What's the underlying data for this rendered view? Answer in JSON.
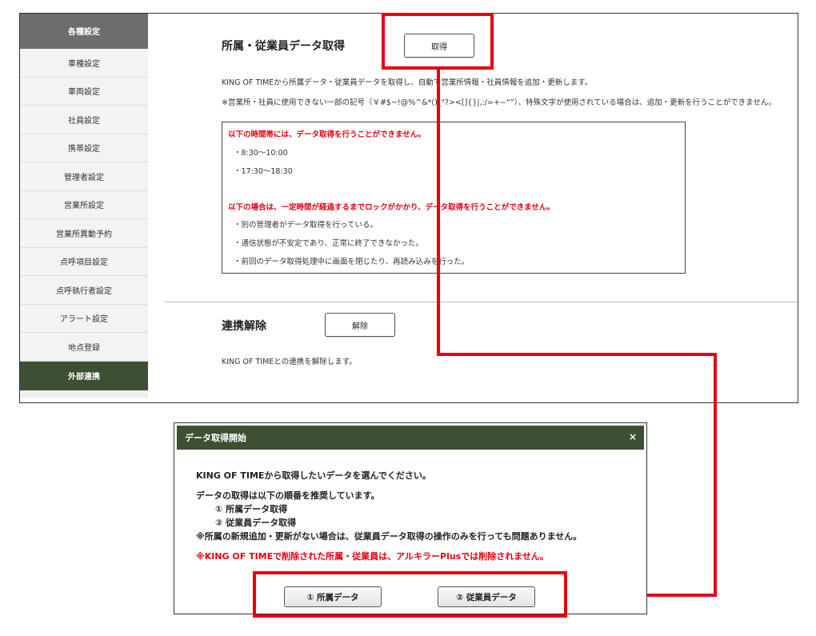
{
  "sidebar": {
    "header": "各種設定",
    "items": [
      {
        "label": "車種設定"
      },
      {
        "label": "車両設定"
      },
      {
        "label": "社員設定"
      },
      {
        "label": "携帯設定"
      },
      {
        "label": "管理者設定"
      },
      {
        "label": "営業所設定"
      },
      {
        "label": "営業所異動予約"
      },
      {
        "label": "点呼項目設定"
      },
      {
        "label": "点呼執行者設定"
      },
      {
        "label": "アラート設定"
      },
      {
        "label": "地点登録"
      }
    ],
    "active": "外部連携"
  },
  "acquire_section": {
    "title": "所属・従業員データ取得",
    "button": "取得",
    "desc1": "KING OF TIMEから所属データ・従業員データを取得し、自動で営業所情報・社員情報を追加・更新します。",
    "desc2": "※営業所・社員に使用できない一部の記号（￥#$~!@%^&*()_\"?><[]{}|,:/=+−“”）、特殊文字が使用されている場合は、追加・更新を行うことができません。",
    "notice": {
      "time_heading": "以下の時間帯には、データ取得を行うことができません。",
      "times": [
        "・8:30〜10:00",
        "・17:30〜18:30"
      ],
      "lock_heading": "以下の場合は、一定時間が経過するまでロックがかかり、データ取得を行うことができません。",
      "cases": [
        "・別の管理者がデータ取得を行っている。",
        "・通信状態が不安定であり、正常に終了できなかった。",
        "・前回のデータ取得処理中に画面を閉じたり、再読み込みを行った。"
      ]
    }
  },
  "unlink_section": {
    "title": "連携解除",
    "button": "解除",
    "desc": "KING OF TIMEとの連携を解除します。"
  },
  "dialog": {
    "title": "データ取得開始",
    "close": "×",
    "line1": "KING OF TIMEから取得したいデータを選んでください。",
    "line2": "データの取得は以下の順番を推奨しています。",
    "step1": "① 所属データ取得",
    "step2": "② 従業員データ取得",
    "note": "※所属の新規追加・更新がない場合は、従業員データ取得の操作のみを行っても問題ありません。",
    "warning": "※KING OF TIMEで削除された所属・従業員は、アルキラーPlusでは削除されません。",
    "btn1": "① 所属データ",
    "btn2": "② 従業員データ"
  },
  "colors": {
    "accent_green": "#3d5034",
    "header_gray": "#6d6d6d",
    "annotation_red": "#e60012"
  }
}
